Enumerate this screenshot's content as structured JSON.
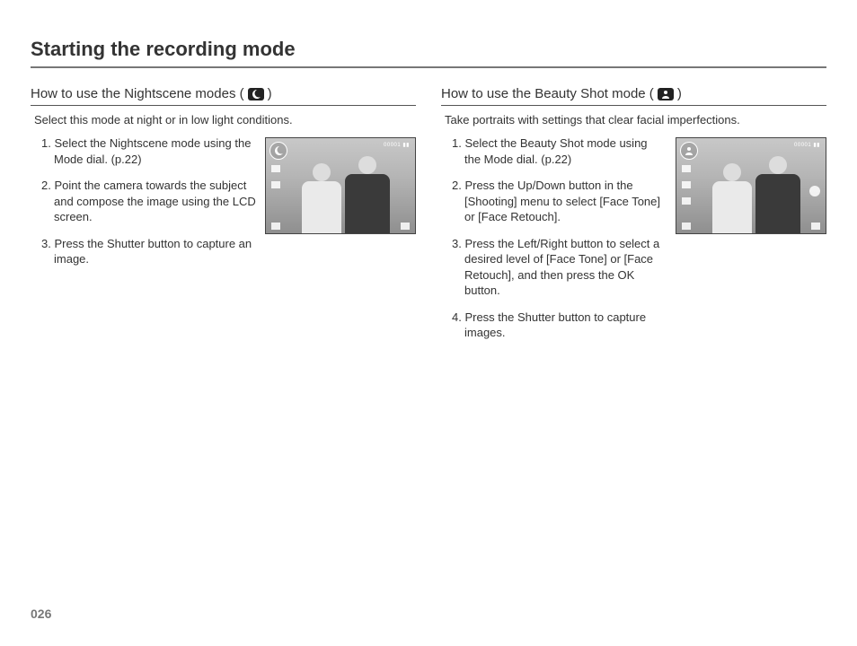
{
  "page_number": "026",
  "title": "Starting the recording mode",
  "left": {
    "heading_prefix": "How to use the Nightscene modes (",
    "heading_suffix": ")",
    "icon": "nightscene-icon",
    "intro": "Select this mode at night or in low light conditions.",
    "steps": [
      "1. Select the Nightscene mode using the Mode dial. (p.22)",
      "2. Point the camera towards the subject and compose the image using the LCD screen.",
      "3. Press the Shutter button to capture an image."
    ],
    "lcd_top_right": "00001  ▮▮"
  },
  "right": {
    "heading_prefix": "How to use the Beauty Shot mode (",
    "heading_suffix": ")",
    "icon": "beauty-shot-icon",
    "intro": "Take portraits with settings that clear facial imperfections.",
    "steps": [
      "1. Select the Beauty Shot mode using the Mode dial. (p.22)",
      "2. Press the Up/Down button in the [Shooting] menu to select [Face Tone] or [Face Retouch].",
      "3. Press the Left/Right button to select a desired level of [Face Tone] or [Face Retouch], and then press the OK button.",
      "4. Press the Shutter button to capture images."
    ],
    "lcd_top_right": "00001  ▮▮"
  }
}
